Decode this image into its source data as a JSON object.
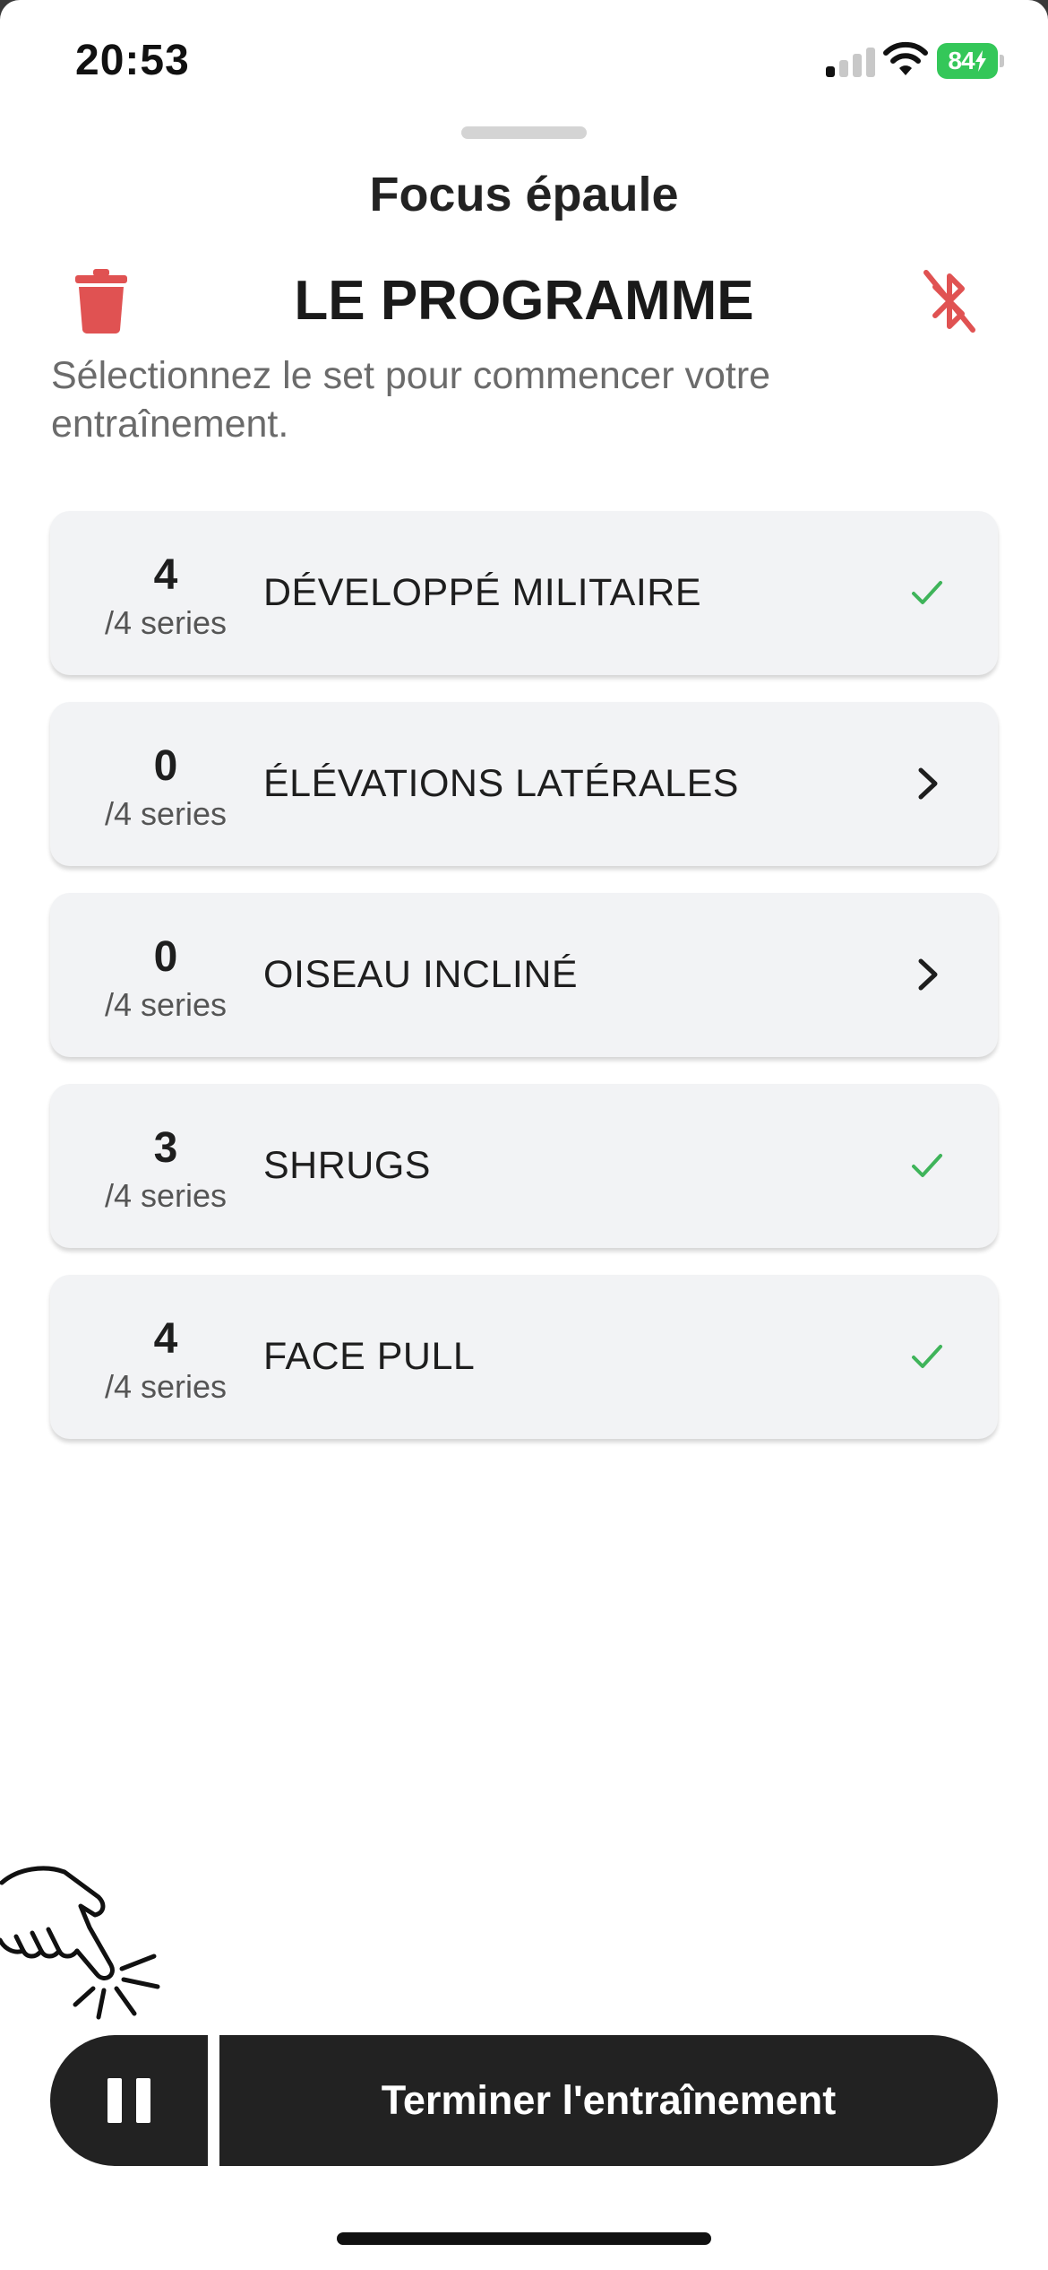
{
  "status_bar": {
    "time": "20:53",
    "battery_level": "84",
    "battery_color": "#34c759"
  },
  "sheet": {
    "title": "Focus épaule"
  },
  "program": {
    "title": "LE PROGRAMME",
    "subtitle": "Sélectionnez le set pour commencer votre entraînement.",
    "delete_icon": "trash-icon",
    "bluetooth_icon": "bluetooth-off-icon",
    "accent_red": "#e05252"
  },
  "exercises": [
    {
      "count": "4",
      "total": "/4 series",
      "name": "DÉVELOPPÉ MILITAIRE",
      "status": "done"
    },
    {
      "count": "0",
      "total": "/4 series",
      "name": "ÉLÉVATIONS LATÉRALES",
      "status": "todo"
    },
    {
      "count": "0",
      "total": "/4 series",
      "name": "OISEAU INCLINÉ",
      "status": "todo"
    },
    {
      "count": "3",
      "total": "/4 series",
      "name": "SHRUGS",
      "status": "done"
    },
    {
      "count": "4",
      "total": "/4 series",
      "name": "FACE PULL",
      "status": "done"
    }
  ],
  "icons": {
    "done": "checkmark-icon",
    "todo": "chevron-right-icon"
  },
  "check_color": "#3fb45a",
  "controls": {
    "pause_icon": "pause-icon",
    "finish_label": "Terminer l'entraînement",
    "button_color": "#222222"
  }
}
